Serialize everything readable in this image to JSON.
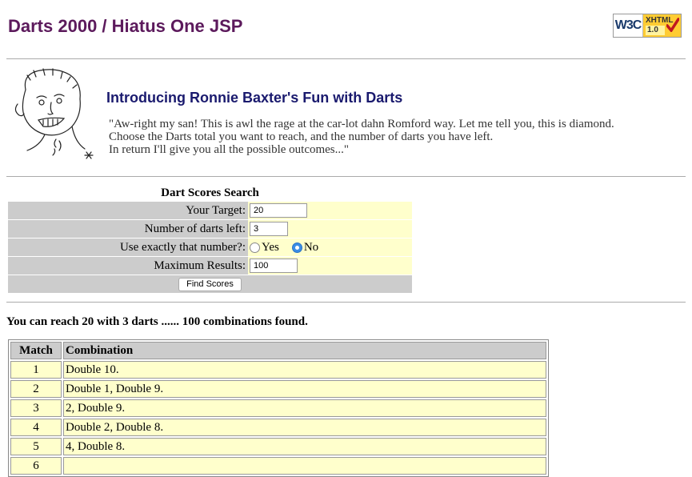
{
  "site": {
    "title": "Darts 2000 / Hiatus One JSP"
  },
  "badge": {
    "left": "W3C",
    "xhtml": "XHTML",
    "version": "1.0"
  },
  "intro": {
    "heading": "Introducing Ronnie Baxter's Fun with Darts",
    "lines": [
      "\"Aw-right my san! This is awl the rage at the car-lot dahn Romford way. Let me tell you, this is diamond.",
      "Choose the Darts total you want to reach, and the number of darts you have left.",
      "In return I'll give you all the possible outcomes...\""
    ]
  },
  "form": {
    "title": "Dart Scores Search",
    "target_label": "Your Target:",
    "target_value": "20",
    "darts_label": "Number of darts left:",
    "darts_value": "3",
    "exact_label": "Use exactly that number?:",
    "yes_label": "Yes",
    "no_label": "No",
    "exact_selected": "No",
    "max_label": "Maximum Results:",
    "max_value": "100",
    "submit_label": "Find Scores"
  },
  "results": {
    "summary": "You can reach 20 with 3 darts ...... 100 combinations found.",
    "headers": [
      "Match",
      "Combination"
    ],
    "rows": [
      [
        "1",
        "Double 10."
      ],
      [
        "2",
        "Double 1, Double 9."
      ],
      [
        "3",
        "2, Double 9."
      ],
      [
        "4",
        "Double 2, Double 8."
      ],
      [
        "5",
        "4, Double 8."
      ],
      [
        "6",
        ""
      ]
    ]
  }
}
